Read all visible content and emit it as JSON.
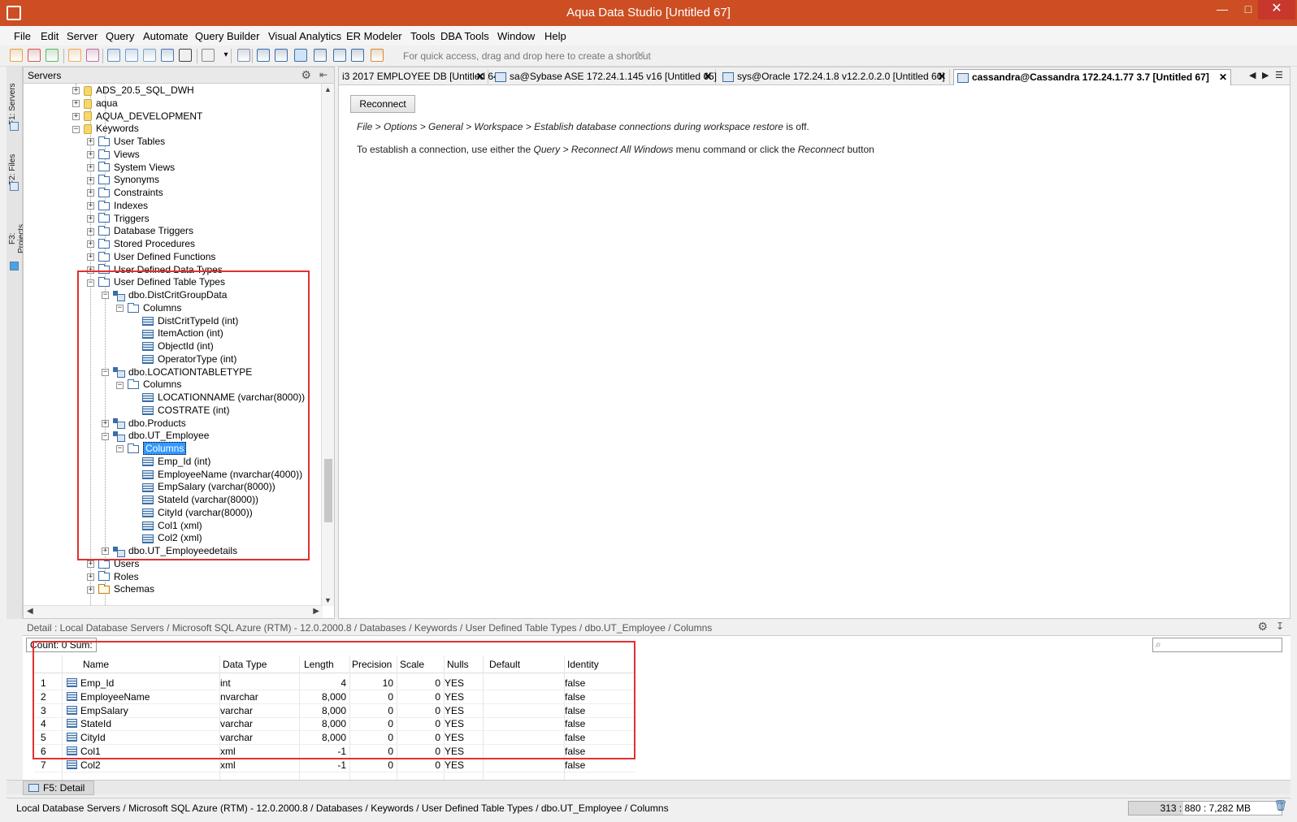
{
  "window": {
    "title": "Aqua Data Studio [Untitled 67]",
    "minimize": "—",
    "maximize": "□",
    "close": "✕"
  },
  "menu": [
    "File",
    "Edit",
    "Server",
    "Query",
    "Automate",
    "Query Builder",
    "Visual Analytics",
    "ER Modeler",
    "Tools",
    "DBA Tools",
    "Window",
    "Help"
  ],
  "toolbar": {
    "shortcut_hint": "For quick access, drag and drop here to create a shortcut",
    "shortcut_close": "✕"
  },
  "side_tabs": [
    "F1: Servers",
    "F2: Files",
    "F3: Projects"
  ],
  "servers_panel": {
    "title": "Servers",
    "gear": "⚙",
    "pin": "⇤"
  },
  "tree": [
    {
      "label": "ADS_20.5_SQL_DWH",
      "exp": "+",
      "icon": "db"
    },
    {
      "label": "aqua",
      "exp": "+",
      "icon": "db"
    },
    {
      "label": "AQUA_DEVELOPMENT",
      "exp": "+",
      "icon": "db"
    },
    {
      "label": "Keywords",
      "exp": "−",
      "icon": "db"
    },
    {
      "label": "User Tables",
      "exp": "+",
      "icon": "folder"
    },
    {
      "label": "Views",
      "exp": "+",
      "icon": "folder"
    },
    {
      "label": "System Views",
      "exp": "+",
      "icon": "folder"
    },
    {
      "label": "Synonyms",
      "exp": "+",
      "icon": "folder"
    },
    {
      "label": "Constraints",
      "exp": "+",
      "icon": "folder"
    },
    {
      "label": "Indexes",
      "exp": "+",
      "icon": "folder"
    },
    {
      "label": "Triggers",
      "exp": "+",
      "icon": "folder"
    },
    {
      "label": "Database Triggers",
      "exp": "+",
      "icon": "folder"
    },
    {
      "label": "Stored Procedures",
      "exp": "+",
      "icon": "folder"
    },
    {
      "label": "User Defined Functions",
      "exp": "+",
      "icon": "folder"
    },
    {
      "label": "User Defined Data Types",
      "exp": "+",
      "icon": "folder"
    },
    {
      "label": "User Defined Table Types",
      "exp": "−",
      "icon": "folder"
    },
    {
      "label": "dbo.DistCritGroupData",
      "exp": "−",
      "icon": "type"
    },
    {
      "label": "Columns",
      "exp": "−",
      "icon": "folder"
    },
    {
      "label": "DistCritTypeId (int)",
      "exp": "",
      "icon": "col"
    },
    {
      "label": "ItemAction (int)",
      "exp": "",
      "icon": "col"
    },
    {
      "label": "ObjectId (int)",
      "exp": "",
      "icon": "col"
    },
    {
      "label": "OperatorType (int)",
      "exp": "",
      "icon": "col"
    },
    {
      "label": "dbo.LOCATIONTABLETYPE",
      "exp": "−",
      "icon": "type"
    },
    {
      "label": "Columns",
      "exp": "−",
      "icon": "folder"
    },
    {
      "label": "LOCATIONNAME (varchar(8000))",
      "exp": "",
      "icon": "col"
    },
    {
      "label": "COSTRATE (int)",
      "exp": "",
      "icon": "col"
    },
    {
      "label": "dbo.Products",
      "exp": "+",
      "icon": "type"
    },
    {
      "label": "dbo.UT_Employee",
      "exp": "−",
      "icon": "type"
    },
    {
      "label": "Columns",
      "exp": "−",
      "icon": "folder",
      "selected": true
    },
    {
      "label": "Emp_Id (int)",
      "exp": "",
      "icon": "col"
    },
    {
      "label": "EmployeeName (nvarchar(4000))",
      "exp": "",
      "icon": "col"
    },
    {
      "label": "EmpSalary (varchar(8000))",
      "exp": "",
      "icon": "col"
    },
    {
      "label": "StateId (varchar(8000))",
      "exp": "",
      "icon": "col"
    },
    {
      "label": "CityId (varchar(8000))",
      "exp": "",
      "icon": "col"
    },
    {
      "label": "Col1 (xml)",
      "exp": "",
      "icon": "col"
    },
    {
      "label": "Col2 (xml)",
      "exp": "",
      "icon": "col"
    },
    {
      "label": "dbo.UT_Employeedetails",
      "exp": "+",
      "icon": "type"
    },
    {
      "label": "Users",
      "exp": "+",
      "icon": "folder"
    },
    {
      "label": "Roles",
      "exp": "+",
      "icon": "folder"
    },
    {
      "label": "Schemas",
      "exp": "+",
      "icon": "folder-tan"
    }
  ],
  "editor": {
    "tabs": [
      {
        "label": "i3 2017 EMPLOYEE DB [Untitled 64]",
        "close": "✕"
      },
      {
        "label": "sa@Sybase ASE 172.24.1.145 v16 [Untitled 65]",
        "close": "✕"
      },
      {
        "label": "sys@Oracle 172.24.1.8 v12.2.0.2.0 [Untitled 66]",
        "close": "✕"
      },
      {
        "label": "cassandra@Cassandra 172.24.1.77 3.7 [Untitled 67]",
        "close": "✕"
      }
    ],
    "nav_prev": "◀",
    "nav_next": "▶",
    "nav_list": "☰",
    "reconnect_label": "Reconnect",
    "msg1_path": "File > Options > General > Workspace > Establish database connections during workspace restore",
    "msg1_tail": " is off.",
    "msg2_a": "To establish a connection, use either the ",
    "msg2_b": "Query > Reconnect All Windows",
    "msg2_c": " menu command or click the ",
    "msg2_d": "Reconnect",
    "msg2_e": " button"
  },
  "detail": {
    "path": "Detail : Local Database Servers / Microsoft SQL Azure (RTM) - 12.0.2000.8 / Databases / Keywords / User Defined Table Types / dbo.UT_Employee / Columns",
    "count": "Count: 0  Sum:",
    "search_icon": "⌕"
  },
  "grid": {
    "headers": [
      "Name",
      "Data Type",
      "Length",
      "Precision",
      "Scale",
      "Nulls",
      "Default",
      "Identity"
    ],
    "rows": [
      {
        "num": "1",
        "name": "Emp_Id",
        "type": "int",
        "length": "4",
        "precision": "10",
        "scale": "0",
        "nulls": "YES",
        "default": "",
        "identity": "false"
      },
      {
        "num": "2",
        "name": "EmployeeName",
        "type": "nvarchar",
        "length": "8,000",
        "precision": "0",
        "scale": "0",
        "nulls": "YES",
        "default": "",
        "identity": "false"
      },
      {
        "num": "3",
        "name": "EmpSalary",
        "type": "varchar",
        "length": "8,000",
        "precision": "0",
        "scale": "0",
        "nulls": "YES",
        "default": "",
        "identity": "false"
      },
      {
        "num": "4",
        "name": "StateId",
        "type": "varchar",
        "length": "8,000",
        "precision": "0",
        "scale": "0",
        "nulls": "YES",
        "default": "",
        "identity": "false"
      },
      {
        "num": "5",
        "name": "CityId",
        "type": "varchar",
        "length": "8,000",
        "precision": "0",
        "scale": "0",
        "nulls": "YES",
        "default": "",
        "identity": "false"
      },
      {
        "num": "6",
        "name": "Col1",
        "type": "xml",
        "length": "-1",
        "precision": "0",
        "scale": "0",
        "nulls": "YES",
        "default": "",
        "identity": "false"
      },
      {
        "num": "7",
        "name": "Col2",
        "type": "xml",
        "length": "-1",
        "precision": "0",
        "scale": "0",
        "nulls": "YES",
        "default": "",
        "identity": "false"
      }
    ]
  },
  "bottom_tab": "F5: Detail",
  "status": {
    "path": "Local Database Servers / Microsoft SQL Azure (RTM) - 12.0.2000.8 / Databases / Keywords / User Defined Table Types / dbo.UT_Employee / Columns",
    "memory": "313 : 880 : 7,282 MB",
    "memory_fraction": 0.356
  },
  "colors": {
    "titlebar": "#cc4e22",
    "highlight_box": "#e03131",
    "selection": "#3399ff"
  }
}
